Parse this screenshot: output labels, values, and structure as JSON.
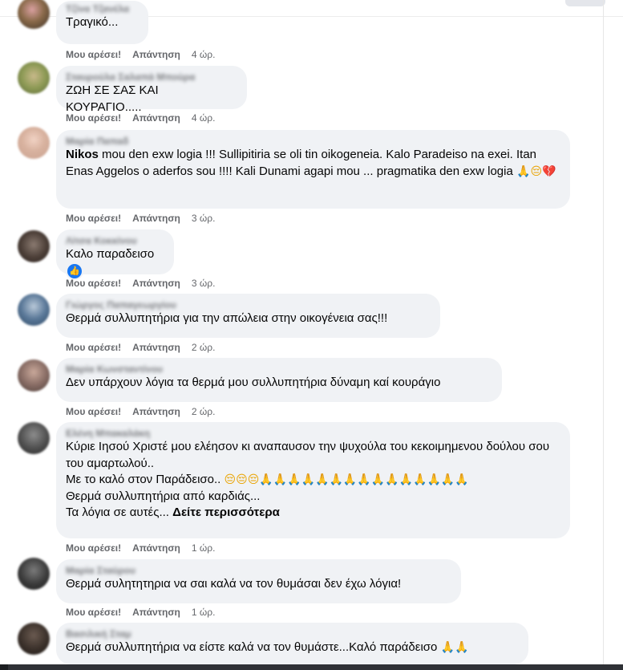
{
  "actions": {
    "like": "Μου αρέσει!",
    "reply": "Απάντηση"
  },
  "comments": [
    {
      "author": "Τζίνα Τζανέλα",
      "text": "Τραγικό...",
      "time": "4 ώρ."
    },
    {
      "author": "Σταυρούλα Σαλαπά Μπούρα",
      "text": "ΖΩΗ ΣΕ ΣΑΣ ΚΑΙ ΚΟΥΡΑΓΙΟ.....",
      "time": "4 ώρ."
    },
    {
      "author": "Μαρία Παπαδ",
      "mention": "Nikos",
      "text": " mou den exw logia !!! Sullipitiria se oli tin oikogeneia. Kalo Paradeiso na exei. Itan Enas Aggelos o aderfos sou !!!! Kali Dunami agapi mou ... pragmatika den exw logia",
      "time": "3 ώρ."
    },
    {
      "author": "Λίτσα Κοκκίνου",
      "text": "Καλο παραδεισο",
      "time": "3 ώρ."
    },
    {
      "author": "Γιώργος Παπαγεωργίου",
      "text": "Θερμά συλλυπητήρια για την απώλεια στην οικογένεια σας!!!",
      "time": "2 ώρ."
    },
    {
      "author": "Μαρία Κωνσταντίνου",
      "text": "Δεν υπάρχουν λόγια τα θερμά μου συλλυπητήρια δύναμη καί κουράγιο",
      "time": "2 ώρ."
    },
    {
      "author": "Ελένη Μπακαλάκη",
      "text_line1": "Κύριε Ιησού Χριστέ μου ελέησον κι αναπαυσον την ψυχούλα του κεκοιμημενου δούλου σου του αμαρτωλού..",
      "text_line2": "Με το καλό στον Παράδεισο..",
      "text_line3": "Θερμά συλλυπητήρια από καρδιάς...",
      "text_line4": "Τα λόγια σε αυτές...",
      "see_more": "Δείτε περισσότερα",
      "time": "1 ώρ."
    },
    {
      "author": "Μαρία Σταύρου",
      "text": "Θερμά συλητητηρια να σαι καλά να τον θυμάσαι δεν έχω λόγια!",
      "time": "1 ώρ."
    },
    {
      "author": "Βασιλική Σταμ",
      "text": "Θερμά συλλυπητήρια να είστε καλά να τον θυμάστε...Καλό παράδεισο",
      "time": ""
    }
  ],
  "colors": {
    "bubble": "#f0f2f5",
    "meta": "#65676b",
    "text": "#050505",
    "like_badge": "#1877f2"
  },
  "icons": {
    "like_badge": "thumbs-up-icon",
    "pray": "folded-hands-emoji",
    "sad": "pensive-face-emoji",
    "heart": "broken-heart-emoji"
  }
}
